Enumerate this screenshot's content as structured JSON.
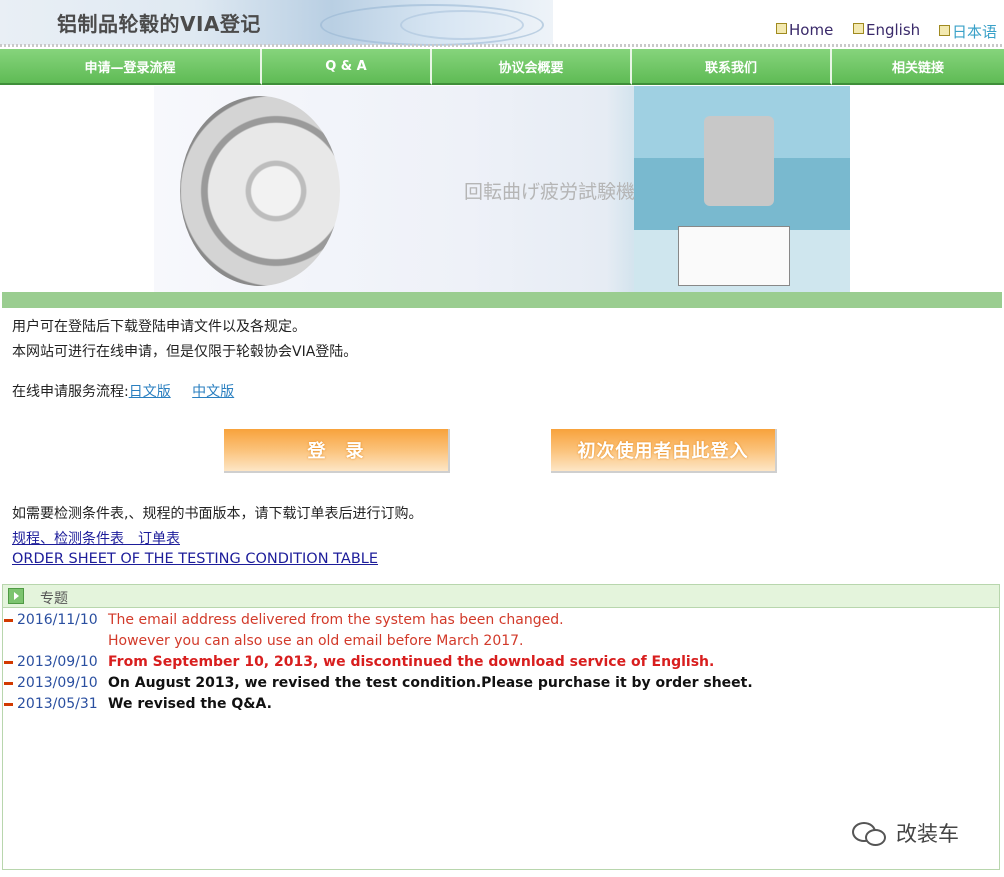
{
  "header": {
    "title": "铝制品轮毂的VIA登记"
  },
  "lang_links": [
    "Home",
    "English",
    "日本语"
  ],
  "nav": [
    "申请—登录流程",
    "Q & A",
    "协议会概要",
    "联系我们",
    "相关链接"
  ],
  "banner": {
    "caption": "回転曲げ疲労試験機"
  },
  "intro": {
    "line1": "用户可在登陆后下载登陆申请文件以及各规定。",
    "line2": "本网站可进行在线申请，但是仅限于轮毂协会VIA登陆。",
    "flow_label": "在线申请服务流程:",
    "flow_link_ja": "日文版",
    "flow_link_cn": "中文版"
  },
  "buttons": {
    "login": "登　录",
    "first_time": "初次使用者由此登入"
  },
  "order": {
    "note": "如需要检测条件表,、规程的书面版本，请下载订单表后进行订购。",
    "link_cn": "规程、检测条件表　订单表",
    "link_en": "ORDER SHEET OF THE TESTING CONDITION TABLE"
  },
  "news": {
    "heading": "专题",
    "items": [
      {
        "date": "2016/11/10",
        "line1": "The email address delivered from the system has been changed.",
        "line2": "However you can also use an old email before March 2017."
      },
      {
        "date": "2013/09/10",
        "line1": "From September 10, 2013, we discontinued the download service of English."
      },
      {
        "date": "2013/09/10",
        "line1": "On August 2013, we revised the test condition.Please purchase it by order sheet."
      },
      {
        "date": "2013/05/31",
        "line1": "We revised the Q&A."
      }
    ]
  },
  "watermark": "改装车",
  "colors": {
    "nav_green": "#6cc262",
    "accent_orange": "#f8a23c",
    "news_red": "#d23a2a"
  }
}
